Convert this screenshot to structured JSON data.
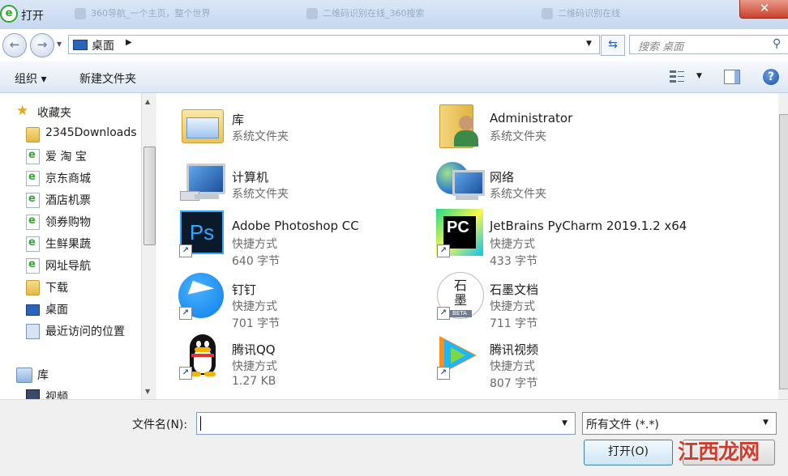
{
  "window": {
    "title": "打开",
    "bg_tabs": [
      "360导航_一个主页，整个世界",
      "二维码识别在线_360搜索",
      "二维码识别在线"
    ],
    "close_glyph": "✕"
  },
  "address": {
    "location": "桌面",
    "search_placeholder": "搜索 桌面"
  },
  "toolbar": {
    "organize_label": "组织 ▾",
    "new_folder_label": "新建文件夹",
    "help_glyph": "?"
  },
  "nav": {
    "favorites_label": "收藏夹",
    "favorites": [
      {
        "label": "2345Downloads",
        "icon": "folder"
      },
      {
        "label": "爱 淘 宝",
        "icon": "ie-shortcut"
      },
      {
        "label": "京东商城",
        "icon": "ie-shortcut"
      },
      {
        "label": "酒店机票",
        "icon": "ie-shortcut"
      },
      {
        "label": "领券购物",
        "icon": "ie-shortcut"
      },
      {
        "label": "生鲜果蔬",
        "icon": "ie-shortcut"
      },
      {
        "label": "网址导航",
        "icon": "ie-shortcut"
      },
      {
        "label": "下载",
        "icon": "download-folder"
      },
      {
        "label": "桌面",
        "icon": "desktop"
      },
      {
        "label": "最近访问的位置",
        "icon": "recent"
      }
    ],
    "libraries_label": "库",
    "libraries": [
      {
        "label": "视频",
        "icon": "video-library"
      }
    ]
  },
  "files": [
    {
      "name": "库",
      "type": "系统文件夹",
      "size": "",
      "icon": "library-folder",
      "shortcut": false
    },
    {
      "name": "Administrator",
      "type": "系统文件夹",
      "size": "",
      "icon": "user-folder",
      "shortcut": false
    },
    {
      "name": "计算机",
      "type": "系统文件夹",
      "size": "",
      "icon": "computer",
      "shortcut": false
    },
    {
      "name": "网络",
      "type": "系统文件夹",
      "size": "",
      "icon": "network-globe",
      "shortcut": false
    },
    {
      "name": "Adobe Photoshop CC",
      "type": "快捷方式",
      "size": "640 字节",
      "icon": "photoshop",
      "shortcut": true,
      "badge": "Ps"
    },
    {
      "name": "JetBrains PyCharm 2019.1.2 x64",
      "type": "快捷方式",
      "size": "433 字节",
      "icon": "pycharm",
      "shortcut": true,
      "badge": "PC"
    },
    {
      "name": "钉钉",
      "type": "快捷方式",
      "size": "701 字节",
      "icon": "dingtalk",
      "shortcut": true
    },
    {
      "name": "石墨文档",
      "type": "快捷方式",
      "size": "711 字节",
      "icon": "shimo",
      "shortcut": true,
      "badge": "石\n墨",
      "beta": "BETA"
    },
    {
      "name": "腾讯QQ",
      "type": "快捷方式",
      "size": "1.27 KB",
      "icon": "qq-penguin",
      "shortcut": true
    },
    {
      "name": "腾讯视频",
      "type": "快捷方式",
      "size": "807 字节",
      "icon": "tencent-video",
      "shortcut": true
    }
  ],
  "footer": {
    "filename_label": "文件名(N):",
    "filename_value": "",
    "filetype_value": "所有文件 (*.*)",
    "open_label": "打开(O)"
  },
  "watermark": "江西龙网"
}
